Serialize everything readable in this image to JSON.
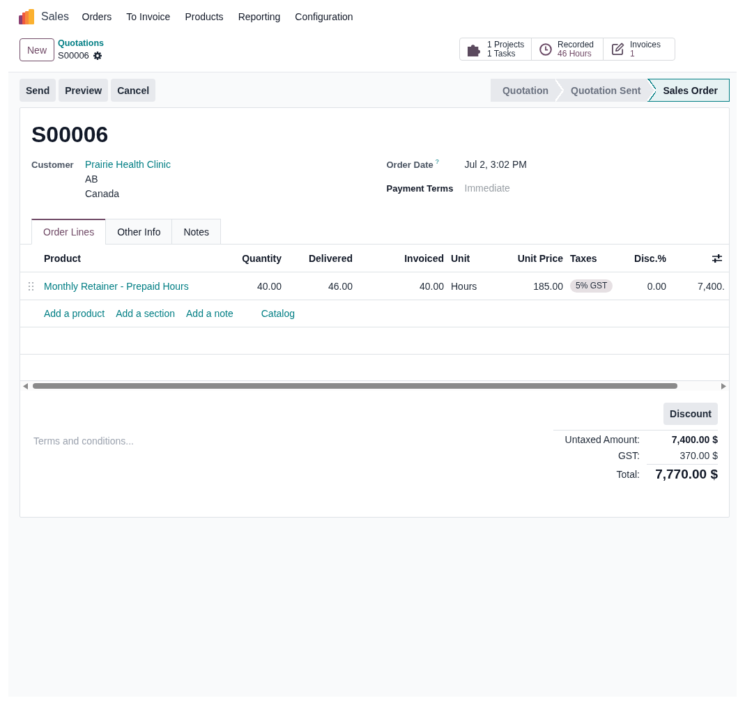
{
  "app": {
    "name": "Sales"
  },
  "menu": [
    {
      "label": "Orders"
    },
    {
      "label": "To Invoice"
    },
    {
      "label": "Products"
    },
    {
      "label": "Reporting"
    },
    {
      "label": "Configuration"
    }
  ],
  "control_panel": {
    "new_button": "New",
    "breadcrumb": {
      "parent": "Quotations",
      "current": "S00006"
    }
  },
  "smart_buttons": [
    {
      "kind": "projects",
      "lines": [
        "1 Projects",
        "1 Tasks"
      ]
    },
    {
      "kind": "timesheets",
      "label": "Recorded",
      "value": "46 Hours"
    },
    {
      "kind": "invoices",
      "label": "Invoices",
      "value": "1"
    }
  ],
  "action_buttons": [
    "Send",
    "Preview",
    "Cancel"
  ],
  "status_steps": [
    {
      "label": "Quotation",
      "selected": false
    },
    {
      "label": "Quotation Sent",
      "selected": false
    },
    {
      "label": "Sales Order",
      "selected": true
    }
  ],
  "sheet": {
    "title": "S00006",
    "customer": {
      "label": "Customer",
      "readonly": true,
      "name": "Prairie Health Clinic",
      "address_lines": [
        "AB",
        "Canada"
      ]
    },
    "order_date": {
      "label": "Order Date",
      "readonly": true,
      "help_mark": "?",
      "value": "Jul 2, 3:02 PM"
    },
    "payment_terms": {
      "label": "Payment Terms",
      "readonly": false,
      "placeholder": "Immediate"
    },
    "tabs": [
      {
        "label": "Order Lines",
        "selected": true
      },
      {
        "label": "Other Info",
        "selected": false
      },
      {
        "label": "Notes",
        "selected": false
      }
    ],
    "order_lines": {
      "columns": [
        {
          "label": "Product",
          "kind": "link"
        },
        {
          "label": "Quantity",
          "kind": "number"
        },
        {
          "label": "Delivered",
          "kind": "number"
        },
        {
          "label": "Invoiced",
          "kind": "number"
        },
        {
          "label": "Unit",
          "kind": "text"
        },
        {
          "label": "Unit Price",
          "kind": "number"
        },
        {
          "label": "Taxes",
          "kind": "tags"
        },
        {
          "label": "Disc.%",
          "kind": "number"
        },
        {
          "kind": "number"
        }
      ],
      "rows": [
        {
          "cells": [
            "Monthly Retainer - Prepaid Hours",
            "40.00",
            "46.00",
            "40.00",
            "Hours",
            "185.00",
            "5% GST",
            "0.00",
            "7,400."
          ]
        }
      ],
      "add_links": [
        {
          "label": "Add a product",
          "kind": "add_line"
        },
        {
          "label": "Add a section",
          "kind": "add_line"
        },
        {
          "label": "Add a note",
          "kind": "add_line"
        },
        {
          "label": "Catalog",
          "kind": "catalog"
        }
      ]
    },
    "discount_button": "Discount",
    "terms": {
      "placeholder": "Terms and conditions..."
    },
    "totals": [
      {
        "kind": "untaxed",
        "label": "Untaxed Amount:",
        "value": "7,400.00 $"
      },
      {
        "kind": "tax",
        "label": "GST:",
        "value": "370.00 $"
      },
      {
        "kind": "total",
        "label": "Total:",
        "value": "7,770.00 $"
      }
    ]
  }
}
